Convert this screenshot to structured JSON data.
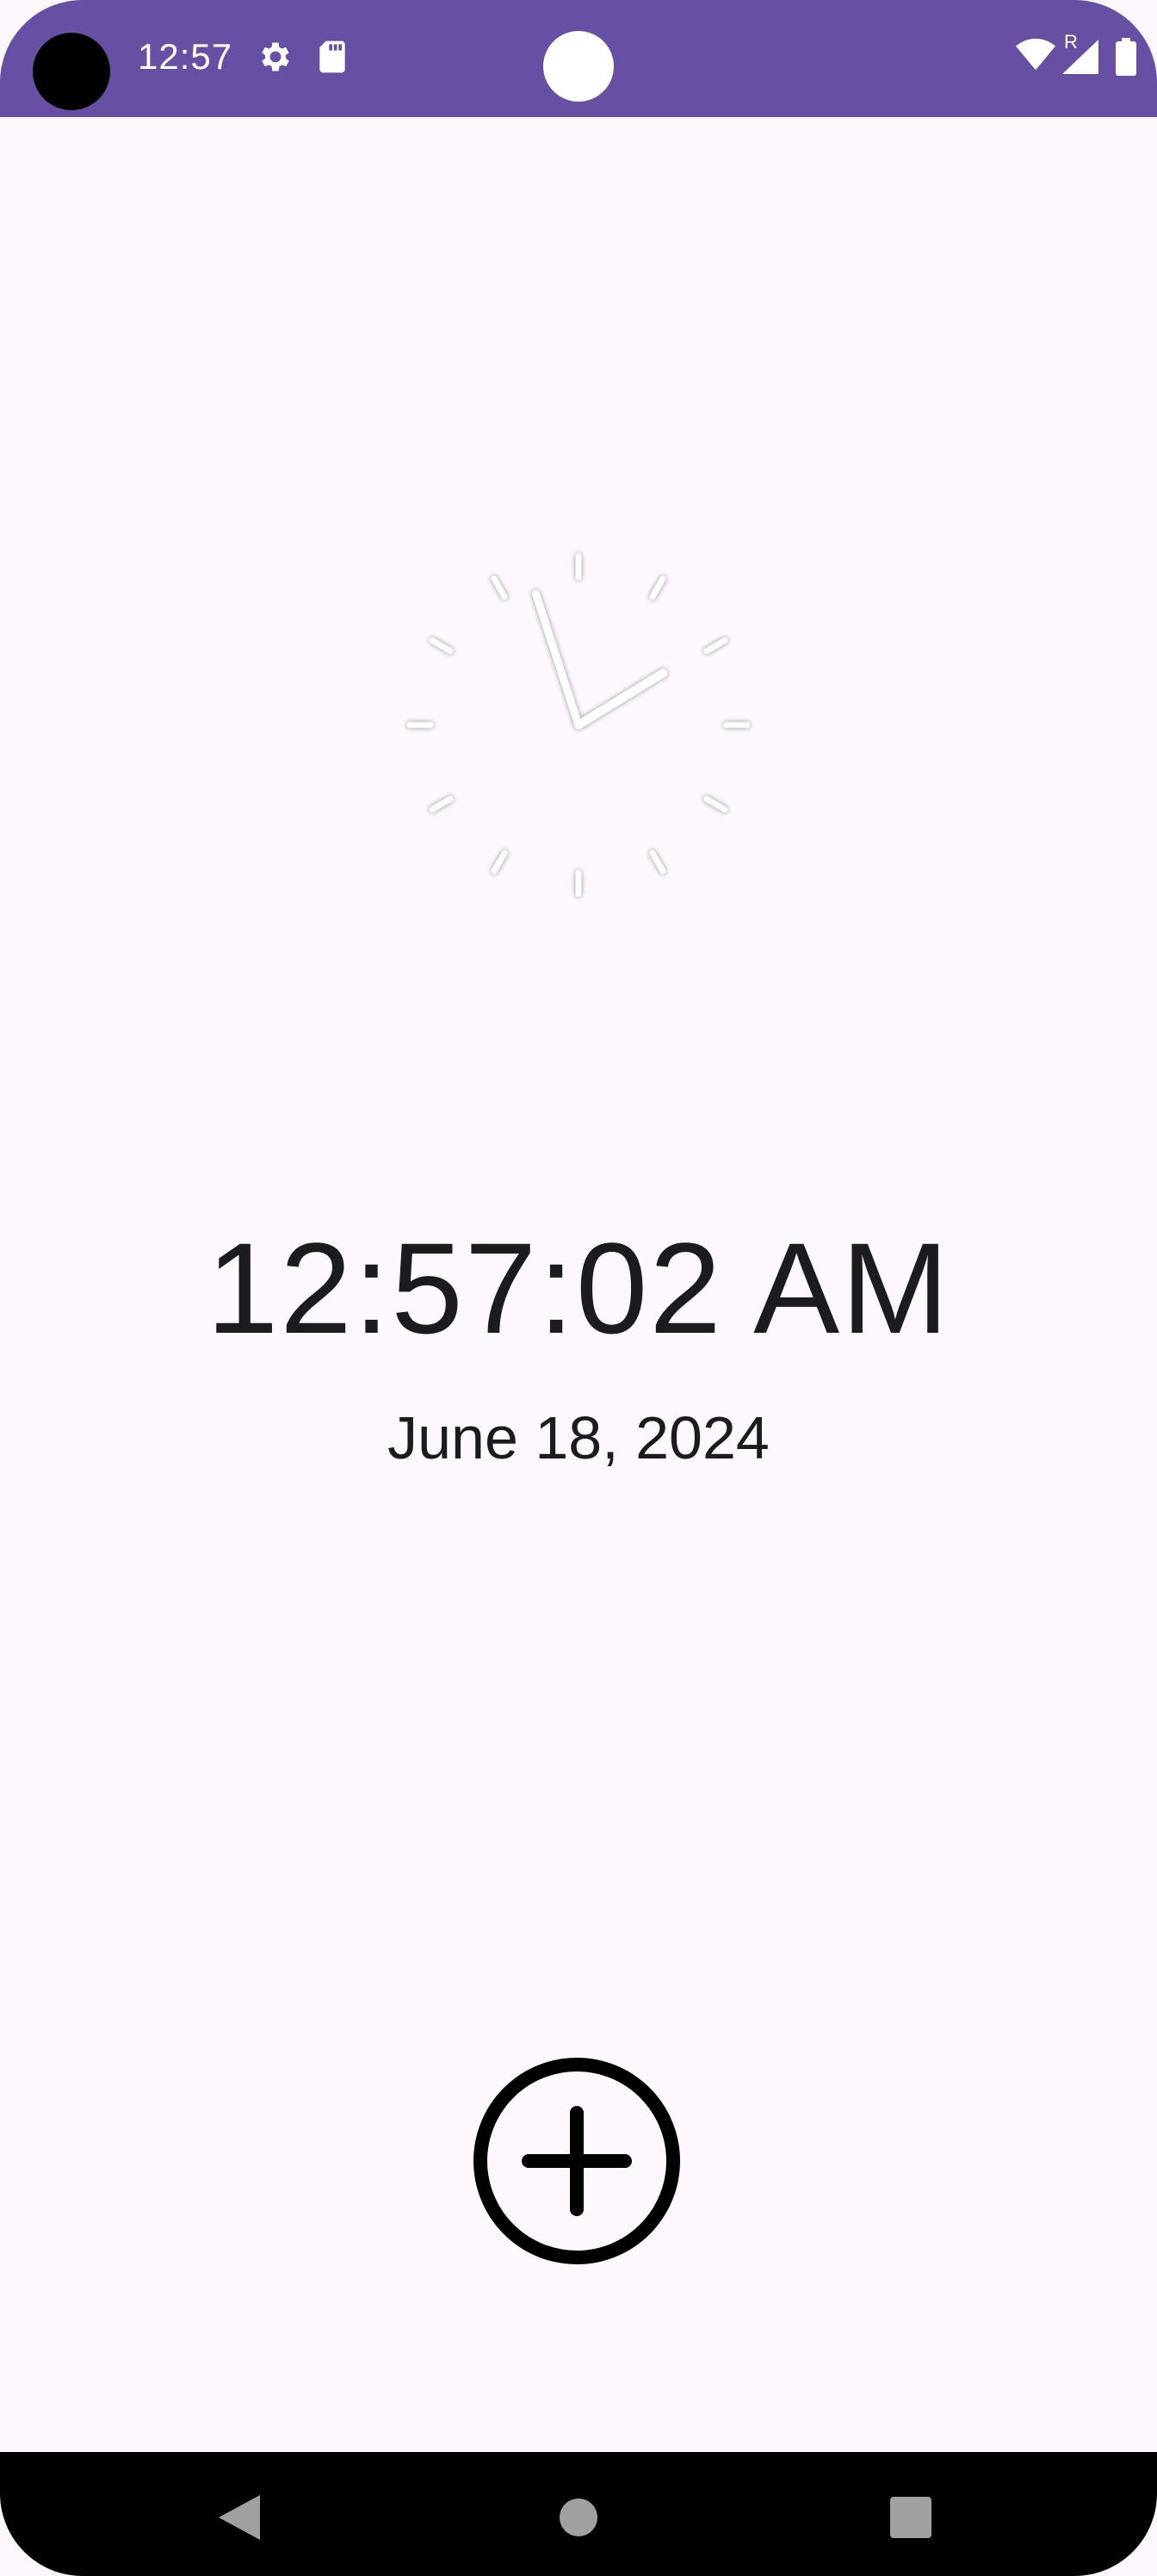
{
  "status_bar": {
    "time": "12:57",
    "background_color": "#6750a4",
    "icons": [
      "settings-icon",
      "sd-card-icon",
      "wifi-icon",
      "signal-icon",
      "battery-icon"
    ],
    "roaming_label": "R"
  },
  "clock": {
    "analog_hours": 12,
    "analog_minutes": 57,
    "digital_time": "12:57:02 AM",
    "date": "June 18, 2024"
  },
  "actions": {
    "add_icon": "add-circle-icon"
  },
  "nav_bar": {
    "items": [
      "back-icon",
      "home-icon",
      "recents-icon"
    ]
  },
  "colors": {
    "background": "#fdf8fd",
    "text": "#1c1b1f"
  }
}
